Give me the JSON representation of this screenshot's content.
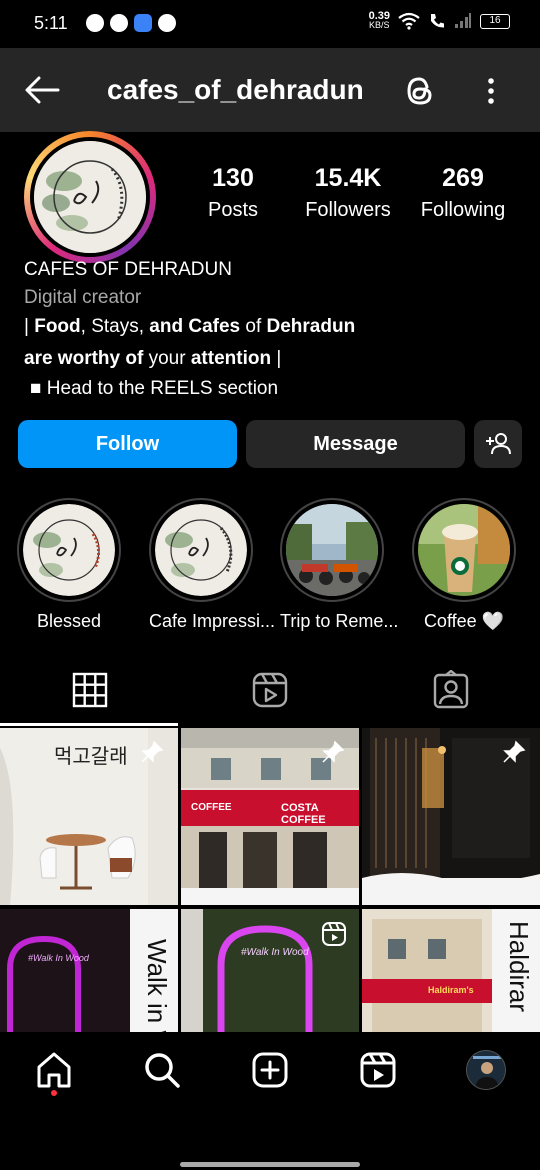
{
  "status": {
    "time": "5:11",
    "speed_top": "0.39",
    "speed_unit": "KB/S",
    "battery": "16"
  },
  "header": {
    "username": "cafes_of_dehradun"
  },
  "profile": {
    "posts": "130",
    "posts_label": "Posts",
    "followers": "15.4K",
    "followers_label": "Followers",
    "following": "269",
    "following_label": "Following",
    "name": "CAFES OF DEHRADUN",
    "category": "Digital creator",
    "bio": {
      "line1_a": "| ",
      "line1_b": "Food",
      "line1_c": ", Stays, ",
      "line1_d": "and Cafes",
      "line1_e": " of ",
      "line1_f": "Dehradun",
      "line2_a": "are worthy of",
      "line2_b": " your ",
      "line2_c": "attention",
      "line2_d": " |",
      "line3": "■ Head to the  REELS section"
    }
  },
  "actions": {
    "follow": "Follow",
    "message": "Message"
  },
  "highlights": [
    {
      "label": "Blessed"
    },
    {
      "label": "Cafe Impressi..."
    },
    {
      "label": "Trip to Reme..."
    },
    {
      "label": "Coffee 🤍"
    }
  ],
  "grid": {
    "tile1_text": "먹고갈래",
    "tile2_sign1": "COFFEE",
    "tile2_sign2": "COSTA COFFEE",
    "tile4_text": "Walk in W",
    "tile4_neon": "#Walk In Wood",
    "tile5_neon": "#Walk In Wood",
    "tile6_text": "Haldirar",
    "tile6_sign": "Haldiram's"
  },
  "colors": {
    "follow_button": "#0095f6",
    "secondary_button": "#262626",
    "header_bg": "#262626"
  }
}
